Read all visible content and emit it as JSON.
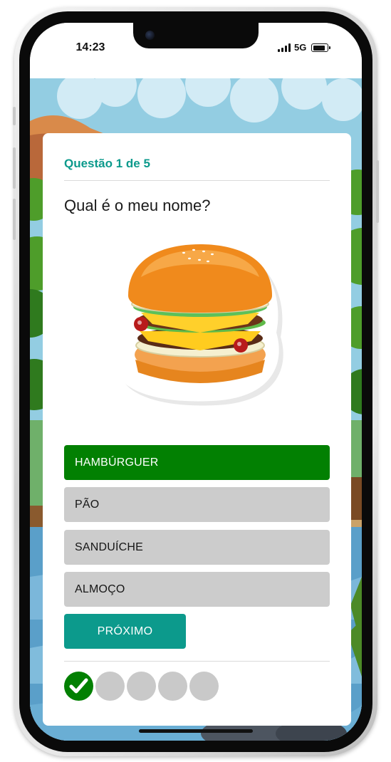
{
  "status_bar": {
    "time": "14:23",
    "network": "5G"
  },
  "quiz": {
    "counter": "Questão 1 de 5",
    "question": "Qual é o meu nome?",
    "image_subject": "hamburger",
    "answers": [
      {
        "label": "HAMBÚRGUER",
        "selected": true
      },
      {
        "label": "PÃO",
        "selected": false
      },
      {
        "label": "SANDUÍCHE",
        "selected": false
      },
      {
        "label": "ALMOÇO",
        "selected": false
      }
    ],
    "next_label": "PRÓXIMO",
    "progress": [
      {
        "state": "correct"
      },
      {
        "state": "pending"
      },
      {
        "state": "pending"
      },
      {
        "state": "pending"
      },
      {
        "state": "pending"
      }
    ]
  },
  "colors": {
    "accent": "#0c9a8c",
    "selected_answer": "#028002",
    "answer_default": "#cccccc",
    "progress_pending": "#c9c9c9"
  },
  "icons": {
    "check": "check-icon",
    "signal": "cellular-signal-icon",
    "battery": "battery-icon",
    "camera": "front-camera-icon"
  }
}
